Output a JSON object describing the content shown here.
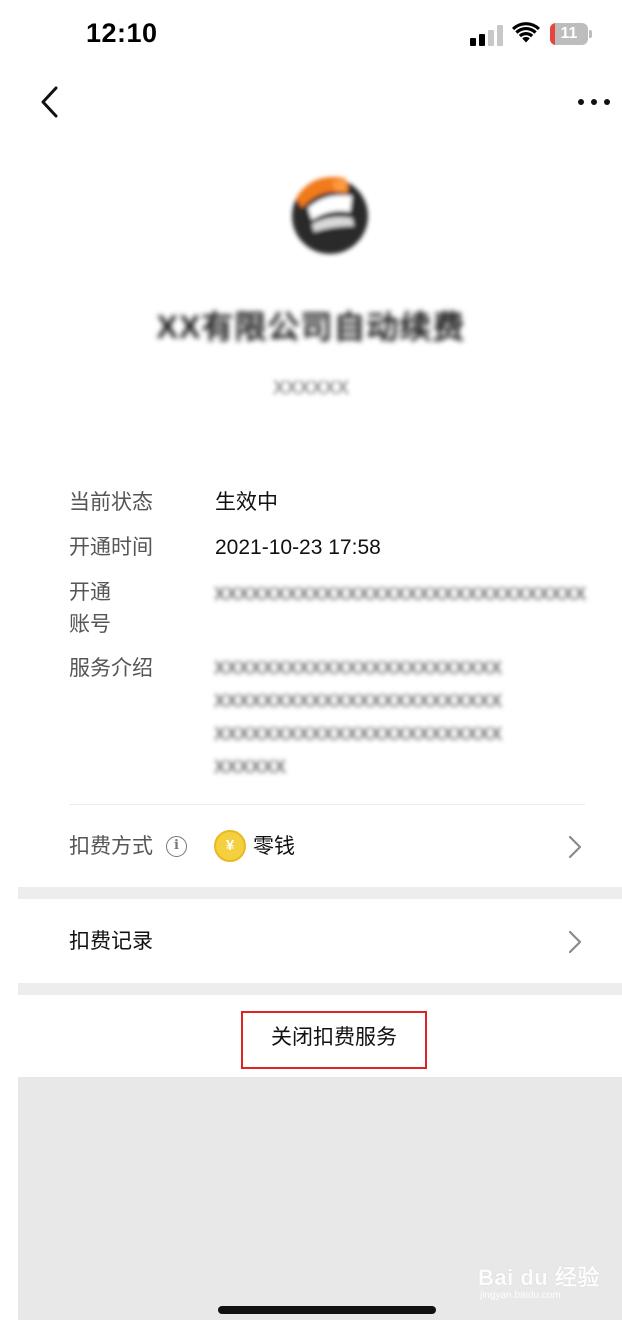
{
  "status_bar": {
    "time": "12:10",
    "battery_level": "11",
    "battery_color": "#e6453c"
  },
  "nav": {
    "back_icon": "chevron-left-icon",
    "more_icon": "more-horizontal-icon"
  },
  "merchant": {
    "name": "XX有限公司自动续费",
    "subtitle": "XXXXXX"
  },
  "details": {
    "status_label": "当前状态",
    "status_value": "生效中",
    "open_time_label": "开通时间",
    "open_time_value": "2021-10-23 17:58",
    "account_label": "开通账号",
    "account_label_line1": "开通",
    "account_label_line2": "账号",
    "account_value": "XXXXXXXXXXXXXXXXXXXXXXXXXXXXXXXXXX",
    "service_label": "服务介绍",
    "service_desc_lines": [
      "XXXXXXXXXXXXXXXXXXXXXXXX",
      "XXXXXXXXXXXXXXXXXXXXXXXX",
      "XXXXXXXXXXXXXXXXXXXXXXXX",
      "XXXXXX"
    ]
  },
  "payment": {
    "label": "扣费方式",
    "info_icon": "info-circle-icon",
    "method": "零钱",
    "coin_symbol": "¥",
    "coin_color": "#f4d03f"
  },
  "records": {
    "label": "扣费记录"
  },
  "close_service": {
    "label": "关闭扣费服务",
    "highlight_color": "#e02424"
  },
  "watermark": {
    "text": "Bai du 经验",
    "sub": "jingyan.baidu.com"
  }
}
